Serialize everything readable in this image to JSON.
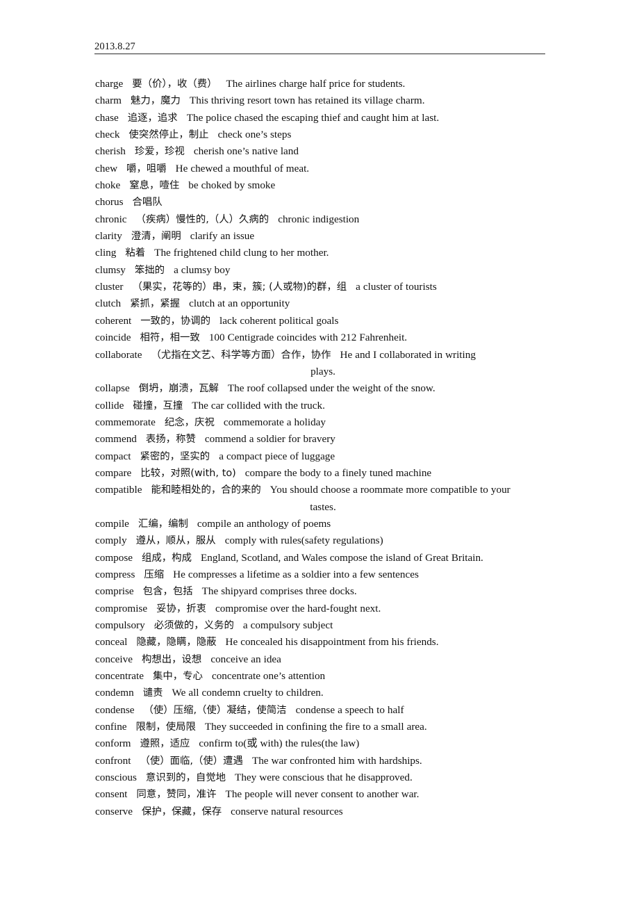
{
  "header": {
    "date": "2013.8.27"
  },
  "entries": [
    {
      "word": "charge",
      "zh": "要（价），收（费）",
      "example": "The airlines charge half price for students."
    },
    {
      "word": "charm",
      "zh": "魅力，魔力",
      "example": "This thriving resort town has retained its village charm."
    },
    {
      "word": "chase",
      "zh": "追逐，追求",
      "example": "The police chased the escaping thief and caught him at last."
    },
    {
      "word": "check",
      "zh": "使突然停止，制止",
      "example": "check one’s steps"
    },
    {
      "word": "cherish",
      "zh": "珍爱，珍视",
      "example": "cherish one’s native land"
    },
    {
      "word": "chew",
      "zh": "嚼，咀嚼",
      "example": "He chewed a mouthful of meat."
    },
    {
      "word": "choke",
      "zh": "窒息，噎住",
      "example": "be choked by smoke"
    },
    {
      "word": "chorus",
      "zh": "合唱队",
      "example": ""
    },
    {
      "word": "chronic",
      "zh": "（疾病）慢性的,（人）久病的",
      "example": "chronic indigestion"
    },
    {
      "word": "clarity",
      "zh": "澄清，阐明",
      "example": "clarify an issue"
    },
    {
      "word": "cling",
      "zh": "粘着",
      "example": "The frightened child clung to her mother."
    },
    {
      "word": "clumsy",
      "zh": "笨拙的",
      "example": "a clumsy boy"
    },
    {
      "word": "cluster",
      "zh": "（果实，花等的）串，束，簇; (人或物)的群，组",
      "example": "a cluster of tourists"
    },
    {
      "word": "clutch",
      "zh": "紧抓，紧握",
      "example": "clutch at an opportunity"
    },
    {
      "word": "coherent",
      "zh": "一致的，协调的",
      "example": "lack coherent political goals"
    },
    {
      "word": "coincide",
      "zh": "相符，相一致",
      "example": "100 Centigrade coincides with 212 Fahrenheit."
    },
    {
      "word": "collaborate",
      "zh": "（尤指在文艺、科学等方面）合作，协作",
      "example": "He and I collaborated in writing",
      "example_last_line": "plays.",
      "wrapped": true
    },
    {
      "word": "collapse",
      "zh": "倒坍，崩溃，瓦解",
      "example": "The roof collapsed under the weight of the snow."
    },
    {
      "word": "collide",
      "zh": "碰撞，互撞",
      "example": "The car collided with the truck."
    },
    {
      "word": "commemorate",
      "zh": "纪念，庆祝",
      "example": "commemorate a holiday"
    },
    {
      "word": "commend",
      "zh": "表扬，称赞",
      "example": "commend a soldier for bravery"
    },
    {
      "word": "compact",
      "zh": "紧密的，坚实的",
      "example": "a compact piece of luggage"
    },
    {
      "word": "compare",
      "zh": "比较，对照(with, to)",
      "example": "compare the body to a finely tuned machine"
    },
    {
      "word": "compatible",
      "zh": "能和睦相处的，合的来的",
      "example": "You should choose a roommate more compatible to your",
      "example_last_line": "tastes.",
      "wrapped": true
    },
    {
      "word": "compile",
      "zh": "汇编，编制",
      "example": "compile an anthology of poems"
    },
    {
      "word": "comply",
      "zh": "遵从，顺从，服从",
      "example": "comply with rules(safety regulations)"
    },
    {
      "word": "compose",
      "zh": "组成，构成",
      "example": "England, Scotland, and Wales compose the island of Great Britain."
    },
    {
      "word": "compress",
      "zh": "压缩",
      "example": "He compresses a lifetime as a soldier into a few sentences"
    },
    {
      "word": "comprise",
      "zh": "包含，包括",
      "example": "The shipyard comprises three docks."
    },
    {
      "word": "compromise",
      "zh": "妥协，折衷",
      "example": "compromise over the hard-fought next."
    },
    {
      "word": "compulsory",
      "zh": "必须做的，义务的",
      "example": "a compulsory subject"
    },
    {
      "word": "conceal",
      "zh": "隐藏，隐瞒，隐蔽",
      "example": "He concealed his disappointment from his friends."
    },
    {
      "word": "conceive",
      "zh": "构想出，设想",
      "example": "conceive an idea"
    },
    {
      "word": "concentrate",
      "zh": "集中，专心",
      "example": "concentrate one’s attention"
    },
    {
      "word": "condemn",
      "zh": "谴责",
      "example": "We all condemn cruelty to children."
    },
    {
      "word": "condense",
      "zh": "（使）压缩,（使）凝结，使简洁",
      "example": "condense a speech to half"
    },
    {
      "word": "confine",
      "zh": "限制，使局限",
      "example": "They succeeded in confining the fire to a small area."
    },
    {
      "word": "conform",
      "zh": "遵照，适应",
      "example": "confirm to(或 with) the rules(the law)"
    },
    {
      "word": "confront",
      "zh": "（使）面临,（使）遭遇",
      "example": "The war confronted him with hardships."
    },
    {
      "word": "conscious",
      "zh": "意识到的，自觉地",
      "example": "They were conscious that he disapproved."
    },
    {
      "word": "consent",
      "zh": "同意，赞同，准许",
      "example": "The people will never consent to another war."
    },
    {
      "word": "conserve",
      "zh": "保护，保藏，保存",
      "example": "conserve natural resources"
    }
  ]
}
